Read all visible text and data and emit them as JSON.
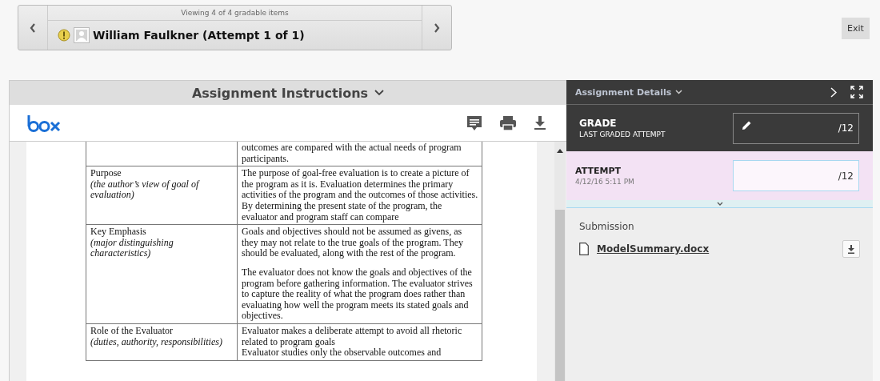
{
  "navigator": {
    "counter": "Viewing 4 of 4 gradable items",
    "student": "William Faulkner (Attempt 1 of 1)"
  },
  "exit_button": "Exit",
  "instructions": {
    "title": "Assignment Instructions",
    "rows": [
      {
        "label": "",
        "note": "",
        "paragraphs": [
          "outcomes are compared with the actual needs of program participants."
        ]
      },
      {
        "label": "Purpose",
        "note": "(the author’s view of goal of evaluation)",
        "paragraphs": [
          "The purpose of goal-free evaluation is to create a picture of the program as it is. Evaluation determines the primary activities of the program and the outcomes of those activities. By determining the present state of the program, the evaluator and program staff can compare"
        ]
      },
      {
        "label": "Key Emphasis",
        "note": "(major distinguishing characteristics)",
        "paragraphs": [
          "Goals and objectives should not be assumed as givens, as they may not relate to the true goals of the program. They should be evaluated, along with the rest of the program.",
          "The evaluator does not know the goals and objectives of the program before gathering information. The evaluator strives to capture the reality of what the program does rather than evaluating how well the program meets its stated goals and objectives."
        ]
      },
      {
        "label": "Role of the Evaluator",
        "note": "(duties, authority, responsibilities)",
        "paragraphs": [
          "Evaluator makes a deliberate attempt to avoid all rhetoric related to program goals",
          "Evaluator studies only the observable outcomes and"
        ]
      }
    ]
  },
  "details": {
    "title": "Assignment Details",
    "grade": {
      "label": "GRADE",
      "sublabel": "LAST GRADED ATTEMPT",
      "value": "/12"
    },
    "attempt": {
      "label": "ATTEMPT",
      "date": "4/12/16 5:11 PM",
      "value": "/12"
    },
    "submission": {
      "label": "Submission",
      "file": "ModelSummary.docx"
    }
  }
}
